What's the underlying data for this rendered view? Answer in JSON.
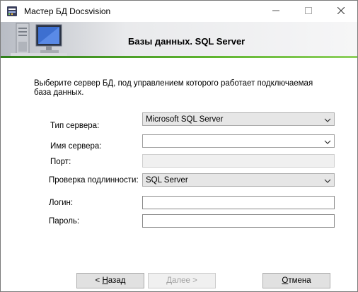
{
  "window": {
    "title": "Мастер БД Docsvision",
    "banner_title": "Базы данных. SQL Server"
  },
  "description": "Выберите сервер БД, под управлением которого работает подключаемая база данных.",
  "form": {
    "server_type_label": "Тип сервера:",
    "server_type_value": "Microsoft SQL Server",
    "server_name_label": "Имя сервера:",
    "server_name_value": "",
    "port_label": "Порт:",
    "port_value": "",
    "auth_label": "Проверка подлинности:",
    "auth_value": "SQL Server",
    "login_label": "Логин:",
    "login_value": "",
    "password_label": "Пароль:",
    "password_value": ""
  },
  "buttons": {
    "back_prefix": "< ",
    "back_mnemonic": "Н",
    "back_rest": "азад",
    "next_mnemonic": "Д",
    "next_rest": "алее >",
    "cancel_mnemonic": "О",
    "cancel_rest": "тмена"
  },
  "icons": {
    "app": "database-wizard-icon",
    "minimize": "minimize-icon",
    "maximize": "maximize-icon",
    "close": "close-icon",
    "banner": "server-computer-illustration",
    "dropdown": "chevron-down-icon"
  },
  "colors": {
    "accent_green": "#5fb52f",
    "banner_gray": "#b8bcc4"
  }
}
